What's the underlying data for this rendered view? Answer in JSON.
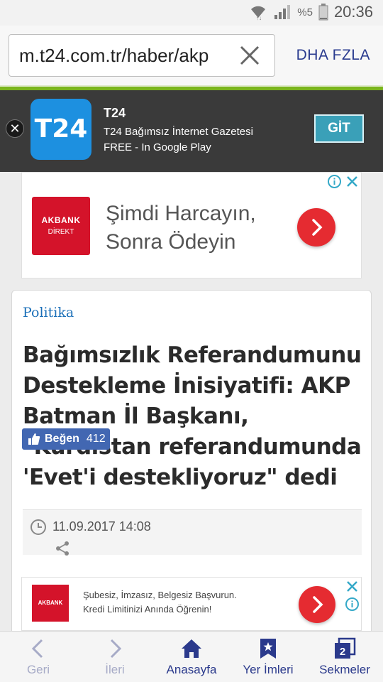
{
  "status_bar": {
    "battery": "%5",
    "time": "20:36"
  },
  "address_bar": {
    "url": "m.t24.com.tr/haber/akp",
    "more_label": "DHA FZLA"
  },
  "app_banner": {
    "icon_text": "T24",
    "name": "T24",
    "description": "T24 Bağımsız İnternet Gazetesi",
    "store": "FREE - In Google Play",
    "button": "GİT"
  },
  "ad_top": {
    "brand_line1": "AKBANK",
    "brand_line2": "DİREKT",
    "text_line1": "Şimdi Harcayın,",
    "text_line2": "Sonra Ödeyin"
  },
  "article": {
    "category": "Politika",
    "headline": "Bağımsızlık Referandumunu Destekleme İnisiyatifi: AKP Batman İl Başkanı, \"Kürdistan referandumunda 'Evet'i destekliyoruz\" dedi",
    "date": "11.09.2017 14:08",
    "like_label": "Beğen",
    "like_count": "412"
  },
  "ad_bottom": {
    "brand": "AKBANK",
    "text_line1": "Şubesiz, İmzasız, Belgesiz Başvurun.",
    "text_line2": "Kredi Limitinizi Anında Öğrenin!"
  },
  "bottom_nav": {
    "back": "Geri",
    "forward": "İleri",
    "home": "Anasayfa",
    "bookmarks": "Yer İmleri",
    "tabs": "Sekmeler",
    "tab_count": "2"
  },
  "colors": {
    "accent": "#2b3a8c",
    "banner_bg": "#3a3a3a",
    "brand_red": "#d4132a",
    "category": "#1b6fb8",
    "green_line": "#7ab51d"
  }
}
